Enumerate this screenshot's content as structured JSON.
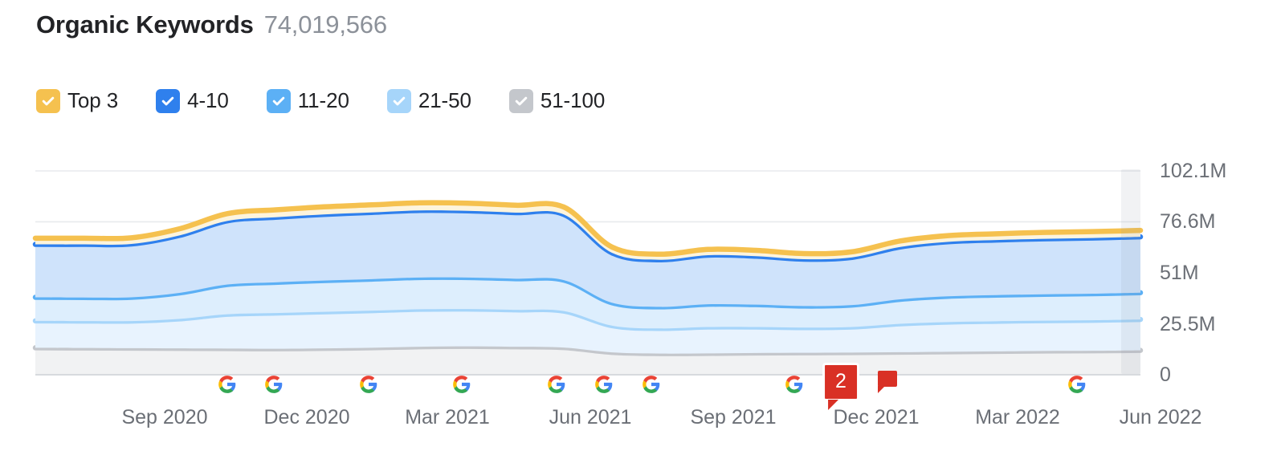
{
  "header": {
    "title": "Organic Keywords",
    "value": "74,019,566"
  },
  "legend": {
    "items": [
      {
        "label": "Top 3",
        "color": "#f5c14f",
        "checked": true,
        "name": "legend-top-3"
      },
      {
        "label": "4-10",
        "color": "#2f80ed",
        "checked": true,
        "name": "legend-4-10"
      },
      {
        "label": "11-20",
        "color": "#5cb0f5",
        "checked": true,
        "name": "legend-11-20"
      },
      {
        "label": "21-50",
        "color": "#a6d5fa",
        "checked": true,
        "name": "legend-21-50"
      },
      {
        "label": "51-100",
        "color": "#c4c7cc",
        "checked": true,
        "name": "legend-51-100"
      }
    ]
  },
  "annotations": {
    "google_update_label": "G",
    "note_count": "2",
    "flag_label": ""
  },
  "chart_data": {
    "type": "area",
    "stacked": true,
    "title": "Organic Keywords",
    "xlabel": "",
    "ylabel": "",
    "grid": true,
    "legend_position": "top",
    "ylim": [
      0,
      102100000
    ],
    "ytick_labels": [
      "102.1M",
      "76.6M",
      "51M",
      "25.5M",
      "0"
    ],
    "ytick_values": [
      102100000,
      76600000,
      51000000,
      25500000,
      0
    ],
    "xtick_labels": [
      "Sep 2020",
      "Dec 2020",
      "Mar 2021",
      "Jun 2021",
      "Sep 2021",
      "Dec 2021",
      "Mar 2022",
      "Jun 2022"
    ],
    "x": [
      "2020-07",
      "2020-08",
      "2020-09",
      "2020-10",
      "2020-11",
      "2020-12",
      "2021-01",
      "2021-02",
      "2021-03",
      "2021-04",
      "2021-05",
      "2021-06",
      "2021-07",
      "2021-08",
      "2021-09",
      "2021-10",
      "2021-11",
      "2021-12",
      "2022-01",
      "2022-02",
      "2022-03",
      "2022-04",
      "2022-05",
      "2022-06"
    ],
    "series": [
      {
        "name": "51-100",
        "color": "#c4c7cc",
        "fill": "#f1f2f3",
        "values": [
          13500000,
          13400000,
          13300000,
          13200000,
          13100000,
          13000000,
          13200000,
          13500000,
          14000000,
          14200000,
          14000000,
          13600000,
          11200000,
          10600000,
          10700000,
          10900000,
          11000000,
          11100000,
          11300000,
          11500000,
          11700000,
          11900000,
          12000000,
          12200000
        ]
      },
      {
        "name": "21-50",
        "color": "#a6d5fa",
        "fill": "#e8f3fe",
        "values": [
          13500000,
          13500000,
          13600000,
          14800000,
          17200000,
          17900000,
          18300000,
          18600000,
          18800000,
          18700000,
          18500000,
          18300000,
          13400000,
          12600000,
          13200000,
          13000000,
          12600000,
          12800000,
          14200000,
          14900000,
          15100000,
          15200000,
          15300000,
          15500000
        ]
      },
      {
        "name": "11-20",
        "color": "#5cb0f5",
        "fill": "#ddeefd",
        "values": [
          11800000,
          11800000,
          11900000,
          13000000,
          14900000,
          15400000,
          15700000,
          15800000,
          15900000,
          15800000,
          15600000,
          15500000,
          11500000,
          10800000,
          11400000,
          11200000,
          10800000,
          11000000,
          12300000,
          12900000,
          13100000,
          13200000,
          13300000,
          13400000
        ]
      },
      {
        "name": "4-10",
        "color": "#2f80ed",
        "fill": "#cfe3fb",
        "values": [
          26500000,
          26600000,
          26700000,
          28800000,
          31900000,
          32600000,
          33100000,
          33400000,
          33600000,
          33400000,
          33100000,
          32900000,
          25000000,
          23600000,
          24600000,
          24300000,
          23500000,
          23900000,
          26200000,
          27300000,
          27600000,
          27800000,
          27900000,
          28000000
        ]
      },
      {
        "name": "Top 3",
        "color": "#f5c14f",
        "fill": "#fdf4dd",
        "values": [
          3100000,
          3100000,
          3100000,
          3300000,
          3600000,
          3700000,
          3800000,
          3800000,
          3800000,
          3800000,
          3700000,
          3700000,
          2900000,
          2800000,
          2900000,
          2900000,
          2800000,
          2800000,
          3000000,
          3100000,
          3100000,
          3200000,
          3200000,
          3200000
        ]
      }
    ]
  }
}
